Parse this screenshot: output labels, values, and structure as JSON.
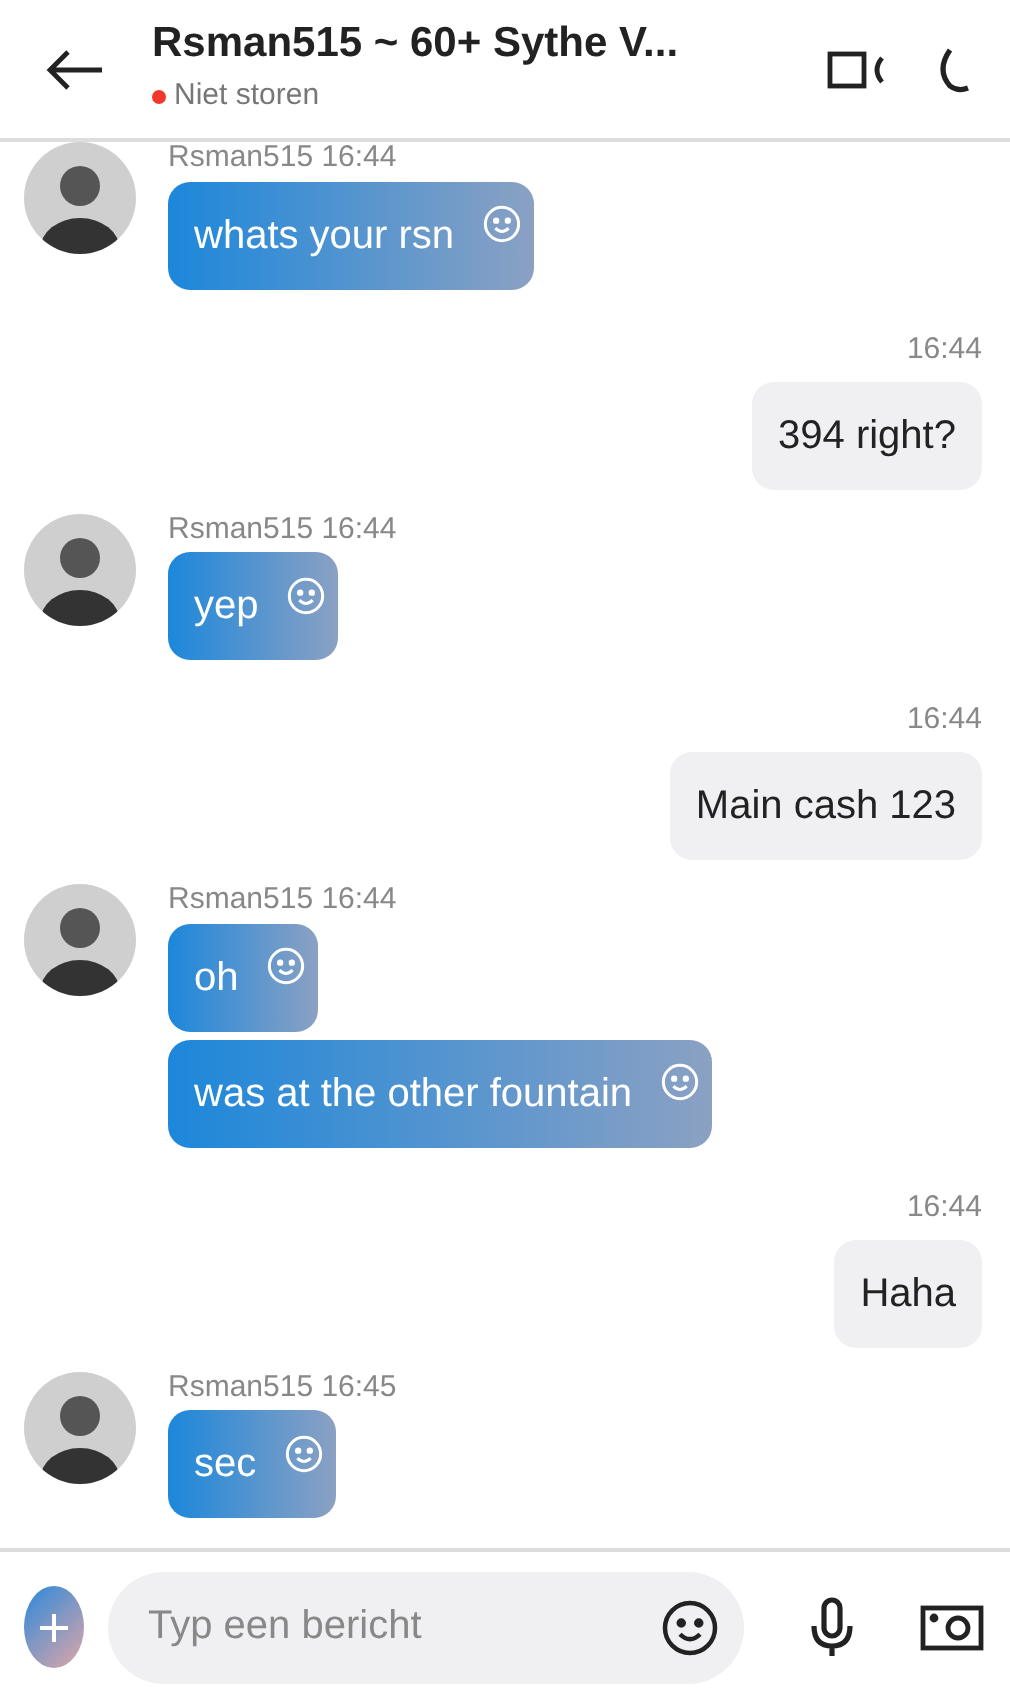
{
  "header": {
    "title": "Rsman515 ~ 60+ Sythe V...",
    "status": {
      "text": "Niet storen",
      "color": "#f0392b"
    }
  },
  "groups": [
    {
      "kind": "incoming",
      "meta": "Rsman515 16:44",
      "messages": [
        "whats your rsn"
      ]
    },
    {
      "kind": "outgoing",
      "meta": "16:44",
      "messages": [
        "394 right?"
      ]
    },
    {
      "kind": "incoming",
      "meta": "Rsman515 16:44",
      "messages": [
        "yep"
      ]
    },
    {
      "kind": "outgoing",
      "meta": "16:44",
      "messages": [
        "Main cash 123"
      ]
    },
    {
      "kind": "incoming",
      "meta": "Rsman515 16:44",
      "messages": [
        "oh",
        "was at the other fountain"
      ]
    },
    {
      "kind": "outgoing",
      "meta": "16:44",
      "messages": [
        "Haha"
      ]
    },
    {
      "kind": "incoming",
      "meta": "Rsman515 16:45",
      "messages": [
        "sec"
      ]
    }
  ],
  "composer": {
    "placeholder": "Typ een bericht"
  }
}
